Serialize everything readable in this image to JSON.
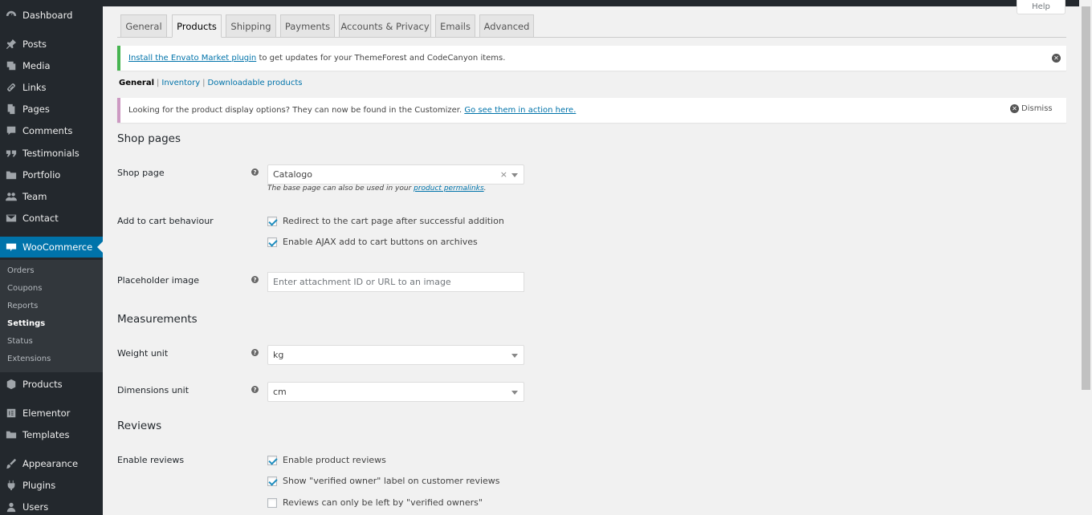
{
  "sidebar": {
    "items": [
      {
        "label": "Dashboard",
        "icon": "dashboard-icon"
      },
      {
        "label": "Posts",
        "icon": "pin-icon"
      },
      {
        "label": "Media",
        "icon": "media-icon"
      },
      {
        "label": "Links",
        "icon": "link-icon"
      },
      {
        "label": "Pages",
        "icon": "page-icon"
      },
      {
        "label": "Comments",
        "icon": "comment-icon"
      },
      {
        "label": "Testimonials",
        "icon": "quote-icon"
      },
      {
        "label": "Portfolio",
        "icon": "portfolio-icon"
      },
      {
        "label": "Team",
        "icon": "team-icon"
      },
      {
        "label": "Contact",
        "icon": "mail-icon"
      },
      {
        "label": "WooCommerce",
        "icon": "woo-icon"
      },
      {
        "label": "Products",
        "icon": "box-icon"
      },
      {
        "label": "Elementor",
        "icon": "elementor-icon"
      },
      {
        "label": "Templates",
        "icon": "folder-icon"
      },
      {
        "label": "Appearance",
        "icon": "brush-icon"
      },
      {
        "label": "Plugins",
        "icon": "plugin-icon"
      },
      {
        "label": "Users",
        "icon": "users-icon"
      }
    ],
    "submenu": [
      "Orders",
      "Coupons",
      "Reports",
      "Settings",
      "Status",
      "Extensions"
    ]
  },
  "help_tab": "Help",
  "tabs": [
    "General",
    "Products",
    "Shipping",
    "Payments",
    "Accounts & Privacy",
    "Emails",
    "Advanced"
  ],
  "notice_envato": {
    "link": "Install the Envato Market plugin",
    "text": " to get updates for your ThemeForest and CodeCanyon items."
  },
  "subnav": {
    "current": "General",
    "links": [
      "Inventory",
      "Downloadable products"
    ]
  },
  "notice_wc": {
    "text": "Looking for the product display options? They can now be found in the Customizer. ",
    "link": "Go see them in action here.",
    "dismiss": "Dismiss"
  },
  "form": {
    "shop_pages_heading": "Shop pages",
    "shop_page_label": "Shop page",
    "shop_page_value": "Catalogo",
    "shop_page_desc_prefix": "The base page can also be used in your ",
    "shop_page_desc_link": "product permalinks",
    "shop_page_desc_suffix": ".",
    "add_to_cart_label": "Add to cart behaviour",
    "redirect_label": "Redirect to the cart page after successful addition",
    "ajax_label": "Enable AJAX add to cart buttons on archives",
    "placeholder_label": "Placeholder image",
    "placeholder_input": "Enter attachment ID or URL to an image",
    "measurements_heading": "Measurements",
    "weight_label": "Weight unit",
    "weight_value": "kg",
    "dimensions_label": "Dimensions unit",
    "dimensions_value": "cm",
    "reviews_heading": "Reviews",
    "enable_reviews_label": "Enable reviews",
    "product_reviews_label": "Enable product reviews",
    "verified_label_label": "Show \"verified owner\" label on customer reviews",
    "verified_only_label": "Reviews can only be left by \"verified owners\""
  },
  "colors": {
    "accent": "#0073aa",
    "sidebar_bg": "#23282d",
    "envato_border": "#46b450",
    "woo_notice_border": "#cc99c2"
  }
}
